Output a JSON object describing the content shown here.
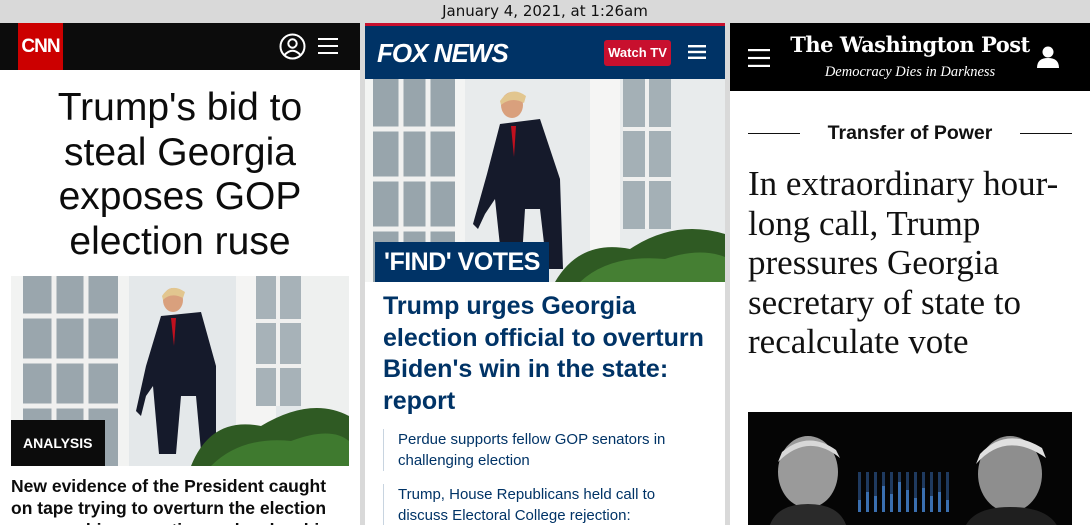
{
  "screenshot": {
    "caption": "January 4, 2021, at 1:26am"
  },
  "cnn": {
    "logo": "CNN",
    "icons": {
      "user": "user-circle-icon",
      "menu": "hamburger-menu-icon"
    },
    "headline": "Trump's bid to steal Georgia exposes GOP election ruse",
    "tag": "ANALYSIS",
    "subhead": "New evidence of the President caught on tape trying to overturn the election exposes his corruption and makes his"
  },
  "fox": {
    "logo": "FOX NEWS",
    "watch_label": "Watch TV",
    "icons": {
      "menu": "hamburger-menu-icon"
    },
    "tag": "'FIND' VOTES",
    "headline": "Trump urges Georgia election official to overturn Biden's win in the state: report",
    "links": [
      "Perdue supports fellow GOP senators in challenging election",
      "Trump, House Republicans held call to discuss Electoral College rejection:"
    ]
  },
  "wapo": {
    "logo": "The Washington Post",
    "tagline": "Democracy Dies in Darkness",
    "icons": {
      "menu": "hamburger-menu-icon",
      "user": "user-icon"
    },
    "kicker": "Transfer of Power",
    "headline": "In extraordinary hour-long call, Trump pressures Georgia secretary of state to recalculate vote"
  },
  "colors": {
    "cnn_red": "#cc0000",
    "fox_navy": "#003366",
    "fox_red": "#c8102e",
    "wapo_black": "#000000"
  }
}
